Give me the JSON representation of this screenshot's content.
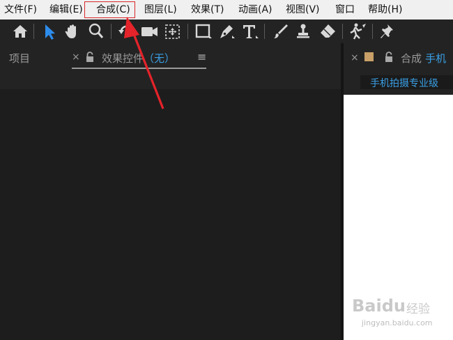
{
  "menubar": {
    "items": [
      "文件(F)",
      "编辑(E)",
      "合成(C)",
      "图层(L)",
      "效果(T)",
      "动画(A)",
      "视图(V)",
      "窗口",
      "帮助(H)"
    ]
  },
  "toolbar": {
    "tools": [
      "home-icon",
      "selection-arrow-icon",
      "hand-icon",
      "zoom-icon",
      "rotate-icon",
      "camera-icon",
      "pan-behind-icon",
      "rectangle-icon",
      "pen-icon",
      "type-icon",
      "brush-icon",
      "clone-stamp-icon",
      "eraser-icon",
      "roto-brush-icon",
      "puppet-pin-icon"
    ],
    "active_tool": "selection-arrow-icon",
    "accent": "#2d8ceb"
  },
  "left_panel": {
    "tab_project": "项目",
    "tab_close": "×",
    "tab_effects": "效果控件",
    "tab_effects_value": "（无）",
    "menu_icon": "≡"
  },
  "right_panel": {
    "tab_close": "×",
    "tab_title": "合成",
    "tab_comp_name": "手机",
    "comp_name_sub": "手机拍摄专业级",
    "label_color": "#c8a068",
    "accent": "#3aa0e6"
  },
  "annotation": {
    "highlight_color": "#d9262b"
  },
  "watermark": {
    "brand": "Baidu",
    "suffix": "经验",
    "url": "jingyan.baidu.com"
  }
}
